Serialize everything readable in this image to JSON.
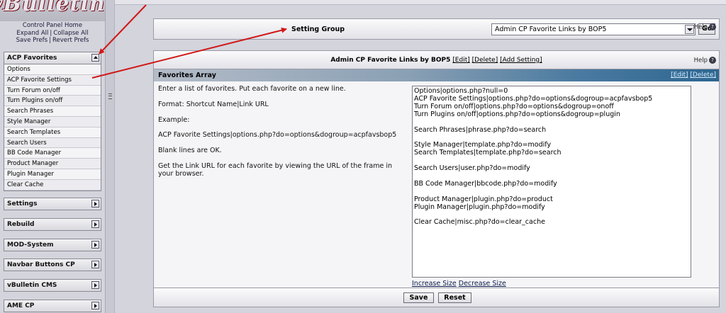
{
  "logo_text": "vBulletin",
  "nav": {
    "links_row1": "Control Panel Home",
    "links_row2a": "Expand All",
    "links_row2b": "Collapse All",
    "links_row3a": "Save Prefs",
    "links_row3b": "Revert Prefs",
    "separator": "|",
    "fav_group": "ACP Favorites",
    "fav_items": [
      "Options",
      "ACP Favorite Settings",
      "Turn Forum on/off",
      "Turn Plugins on/off",
      "Search Phrases",
      "Style Manager",
      "Search Templates",
      "Search Users",
      "BB Code Manager",
      "Product Manager",
      "Plugin Manager",
      "Clear Cache"
    ],
    "groups": [
      "Settings",
      "Rebuild",
      "MOD-System",
      "Navbar Buttons CP",
      "vBulletin CMS",
      "AME CP"
    ]
  },
  "setting_group": {
    "label": "Setting Group",
    "selected": "Admin CP Favorite Links by BOP5",
    "go_label": "Go",
    "help_label": "Help"
  },
  "main": {
    "title": "Admin CP Favorite Links by BOP5",
    "edit": "[Edit]",
    "delete": "[Delete]",
    "add_setting": "[Add Setting]",
    "help_label": "Help",
    "setting_name": "Favorites Array",
    "row_edit": "[Edit]",
    "row_delete": "[Delete]",
    "description": [
      "Enter a list of favorites. Put each favorite on a new line.",
      "Format: Shortcut Name|Link URL",
      "Example:",
      "ACP Favorite Settings|options.php?do=options&dogroup=acpfavsbop5",
      "Blank lines are OK.",
      "Get the Link URL for each favorite by viewing the URL of the frame in your browser."
    ],
    "textarea_value": "Options|options.php?null=0\nACP Favorite Settings|options.php?do=options&dogroup=acpfavsbop5\nTurn Forum on/off|options.php?do=options&dogroup=onoff\nTurn Plugins on/off|options.php?do=options&dogroup=plugin\n\nSearch Phrases|phrase.php?do=search\n\nStyle Manager|template.php?do=modify\nSearch Templates|template.php?do=search\n\nSearch Users|user.php?do=modify\n\nBB Code Manager|bbcode.php?do=modify\n\nProduct Manager|plugin.php?do=product\nPlugin Manager|plugin.php?do=modify\n\nClear Cache|misc.php?do=clear_cache",
    "increase_size": "Increase Size",
    "decrease_size": "Decrease Size",
    "save_label": "Save",
    "reset_label": "Reset"
  },
  "colors": {
    "annotation_arrow": "#d01818",
    "panel_bg": "#f4f4f6",
    "header_bar_end": "#2d6690"
  }
}
